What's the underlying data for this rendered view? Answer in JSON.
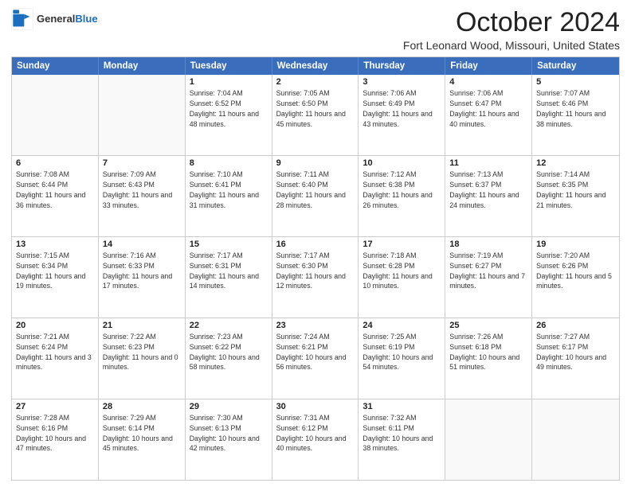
{
  "header": {
    "logo_general": "General",
    "logo_blue": "Blue",
    "month_title": "October 2024",
    "subtitle": "Fort Leonard Wood, Missouri, United States"
  },
  "weekdays": [
    "Sunday",
    "Monday",
    "Tuesday",
    "Wednesday",
    "Thursday",
    "Friday",
    "Saturday"
  ],
  "rows": [
    [
      {
        "day": "",
        "info": ""
      },
      {
        "day": "",
        "info": ""
      },
      {
        "day": "1",
        "info": "Sunrise: 7:04 AM\nSunset: 6:52 PM\nDaylight: 11 hours and 48 minutes."
      },
      {
        "day": "2",
        "info": "Sunrise: 7:05 AM\nSunset: 6:50 PM\nDaylight: 11 hours and 45 minutes."
      },
      {
        "day": "3",
        "info": "Sunrise: 7:06 AM\nSunset: 6:49 PM\nDaylight: 11 hours and 43 minutes."
      },
      {
        "day": "4",
        "info": "Sunrise: 7:06 AM\nSunset: 6:47 PM\nDaylight: 11 hours and 40 minutes."
      },
      {
        "day": "5",
        "info": "Sunrise: 7:07 AM\nSunset: 6:46 PM\nDaylight: 11 hours and 38 minutes."
      }
    ],
    [
      {
        "day": "6",
        "info": "Sunrise: 7:08 AM\nSunset: 6:44 PM\nDaylight: 11 hours and 36 minutes."
      },
      {
        "day": "7",
        "info": "Sunrise: 7:09 AM\nSunset: 6:43 PM\nDaylight: 11 hours and 33 minutes."
      },
      {
        "day": "8",
        "info": "Sunrise: 7:10 AM\nSunset: 6:41 PM\nDaylight: 11 hours and 31 minutes."
      },
      {
        "day": "9",
        "info": "Sunrise: 7:11 AM\nSunset: 6:40 PM\nDaylight: 11 hours and 28 minutes."
      },
      {
        "day": "10",
        "info": "Sunrise: 7:12 AM\nSunset: 6:38 PM\nDaylight: 11 hours and 26 minutes."
      },
      {
        "day": "11",
        "info": "Sunrise: 7:13 AM\nSunset: 6:37 PM\nDaylight: 11 hours and 24 minutes."
      },
      {
        "day": "12",
        "info": "Sunrise: 7:14 AM\nSunset: 6:35 PM\nDaylight: 11 hours and 21 minutes."
      }
    ],
    [
      {
        "day": "13",
        "info": "Sunrise: 7:15 AM\nSunset: 6:34 PM\nDaylight: 11 hours and 19 minutes."
      },
      {
        "day": "14",
        "info": "Sunrise: 7:16 AM\nSunset: 6:33 PM\nDaylight: 11 hours and 17 minutes."
      },
      {
        "day": "15",
        "info": "Sunrise: 7:17 AM\nSunset: 6:31 PM\nDaylight: 11 hours and 14 minutes."
      },
      {
        "day": "16",
        "info": "Sunrise: 7:17 AM\nSunset: 6:30 PM\nDaylight: 11 hours and 12 minutes."
      },
      {
        "day": "17",
        "info": "Sunrise: 7:18 AM\nSunset: 6:28 PM\nDaylight: 11 hours and 10 minutes."
      },
      {
        "day": "18",
        "info": "Sunrise: 7:19 AM\nSunset: 6:27 PM\nDaylight: 11 hours and 7 minutes."
      },
      {
        "day": "19",
        "info": "Sunrise: 7:20 AM\nSunset: 6:26 PM\nDaylight: 11 hours and 5 minutes."
      }
    ],
    [
      {
        "day": "20",
        "info": "Sunrise: 7:21 AM\nSunset: 6:24 PM\nDaylight: 11 hours and 3 minutes."
      },
      {
        "day": "21",
        "info": "Sunrise: 7:22 AM\nSunset: 6:23 PM\nDaylight: 11 hours and 0 minutes."
      },
      {
        "day": "22",
        "info": "Sunrise: 7:23 AM\nSunset: 6:22 PM\nDaylight: 10 hours and 58 minutes."
      },
      {
        "day": "23",
        "info": "Sunrise: 7:24 AM\nSunset: 6:21 PM\nDaylight: 10 hours and 56 minutes."
      },
      {
        "day": "24",
        "info": "Sunrise: 7:25 AM\nSunset: 6:19 PM\nDaylight: 10 hours and 54 minutes."
      },
      {
        "day": "25",
        "info": "Sunrise: 7:26 AM\nSunset: 6:18 PM\nDaylight: 10 hours and 51 minutes."
      },
      {
        "day": "26",
        "info": "Sunrise: 7:27 AM\nSunset: 6:17 PM\nDaylight: 10 hours and 49 minutes."
      }
    ],
    [
      {
        "day": "27",
        "info": "Sunrise: 7:28 AM\nSunset: 6:16 PM\nDaylight: 10 hours and 47 minutes."
      },
      {
        "day": "28",
        "info": "Sunrise: 7:29 AM\nSunset: 6:14 PM\nDaylight: 10 hours and 45 minutes."
      },
      {
        "day": "29",
        "info": "Sunrise: 7:30 AM\nSunset: 6:13 PM\nDaylight: 10 hours and 42 minutes."
      },
      {
        "day": "30",
        "info": "Sunrise: 7:31 AM\nSunset: 6:12 PM\nDaylight: 10 hours and 40 minutes."
      },
      {
        "day": "31",
        "info": "Sunrise: 7:32 AM\nSunset: 6:11 PM\nDaylight: 10 hours and 38 minutes."
      },
      {
        "day": "",
        "info": ""
      },
      {
        "day": "",
        "info": ""
      }
    ]
  ]
}
